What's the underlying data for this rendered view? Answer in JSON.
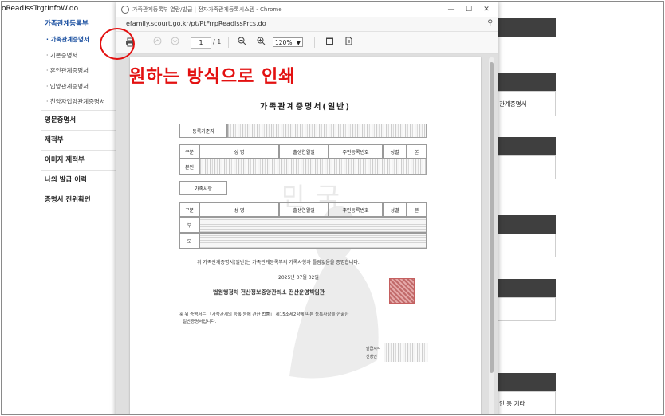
{
  "background_page": {
    "url_fragment": "oReadIssTrgtInfoW.do",
    "sidebar_heading": "가족관계등록부",
    "sub_items": [
      "· 가족관계증명서",
      "· 기본증명서",
      "· 혼인관계증명서",
      "· 입양관계증명서",
      "· 친양자입양관계증명서"
    ],
    "sections": [
      "영문증명서",
      "제적부",
      "이미지 제적부",
      "나의 발급 이력",
      "증명서 진위확인"
    ],
    "right_labels": [
      "관계증명서",
      "인 등 기타"
    ]
  },
  "popup": {
    "title": "가족관계등록부 열람/발급 | 전자가족관계등록시스템 - Chrome",
    "url": "efamily.scourt.go.kr/pt/PtFrrpReadIssPrcs.do",
    "window_buttons": {
      "minimize": "—",
      "maximize": "☐",
      "close": "✕"
    },
    "toolbar": {
      "page_current": "1",
      "page_total": "/ 1",
      "zoom_value": "120%"
    }
  },
  "document": {
    "title": "가족관계증명서(일반)",
    "watermark": "민국",
    "base_label": "등록기준지",
    "header_cols": [
      "구분",
      "성   명",
      "출생연월일",
      "주민등록번호",
      "성별",
      "본"
    ],
    "self_label": "본인",
    "family_label": "가족사항",
    "family_rows": [
      "부",
      "모"
    ],
    "cert_statement": "위 가족관계증명서(일반)는 가족관계등록부의 기록사항과 틀림없음을 증명합니다.",
    "date": "2025년  07월  02일",
    "issuer": "법원행정처 전산정보중앙관리소 전산운영책임관",
    "note_line1": "※ 위 증명서는 「가족관계의 등록 등에 관한 법률」 제15조제2항에 따른 등록사항을 현출한",
    "note_line2": "일반증명서입니다.",
    "issue_label1": "발급시각",
    "issue_label2": "신청인"
  },
  "annotation": {
    "text": "원하는 방식으로 인쇄",
    "color": "#e31010"
  },
  "icons": {
    "print": "print-icon",
    "zoom_out": "zoom-out-icon",
    "zoom_in": "zoom-in-icon"
  }
}
